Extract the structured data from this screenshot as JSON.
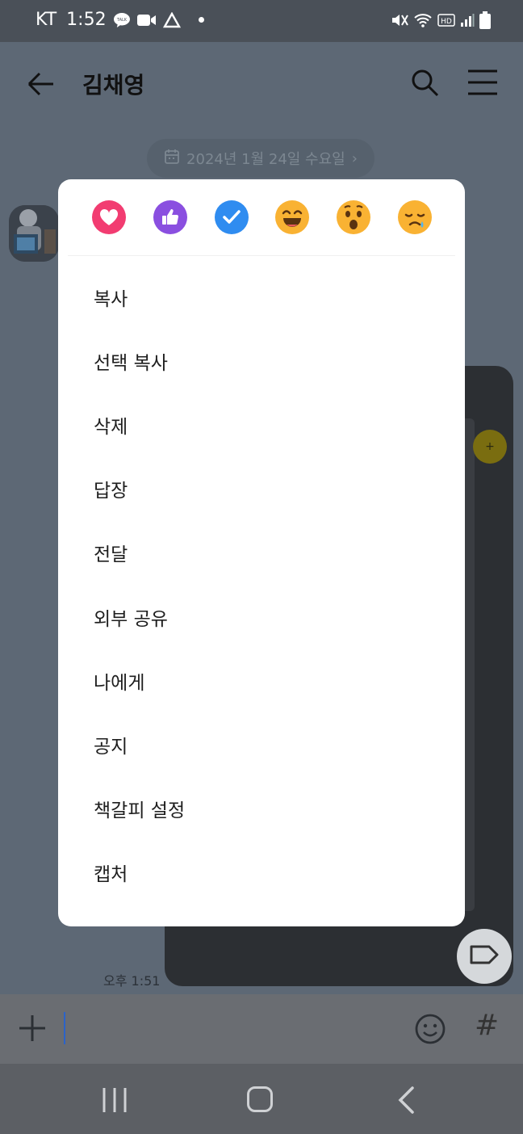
{
  "status_bar": {
    "carrier": "KT",
    "time": "1:52",
    "icons": [
      "talk-icon",
      "video-icon",
      "drive-icon",
      "dot-icon",
      "mute-icon",
      "wifi-icon",
      "hd-icon",
      "signal-icon",
      "battery-icon"
    ],
    "hd_label": "HD",
    "talk_label": "TALK"
  },
  "header": {
    "title": "김채영",
    "icons": [
      "back-arrow-icon",
      "search-icon",
      "menu-icon"
    ]
  },
  "date_chip": {
    "text": "2024년 1월 24일 수요일",
    "icon": "calendar-icon",
    "chevron": "›"
  },
  "message": {
    "time": "오후 1:51",
    "badge": "+"
  },
  "context_menu": {
    "reactions": [
      {
        "name": "heart-reaction",
        "color": "#f23c71"
      },
      {
        "name": "thumbs-up-reaction",
        "color": "#8a4fe0"
      },
      {
        "name": "check-reaction",
        "color": "#2f8cf0"
      },
      {
        "name": "laugh-reaction",
        "color": "#f9b233"
      },
      {
        "name": "surprised-reaction",
        "color": "#f9b233"
      },
      {
        "name": "sad-reaction",
        "color": "#f9b233"
      }
    ],
    "items": [
      "복사",
      "선택 복사",
      "삭제",
      "답장",
      "전달",
      "외부 공유",
      "나에게",
      "공지",
      "책갈피 설정",
      "캡처"
    ]
  },
  "input_bar": {
    "hash_label": "#",
    "icons": [
      "plus-icon",
      "emoji-icon",
      "hash-icon"
    ]
  },
  "nav_bar": {
    "icons": [
      "recent-apps-icon",
      "home-icon",
      "nav-back-icon"
    ]
  }
}
